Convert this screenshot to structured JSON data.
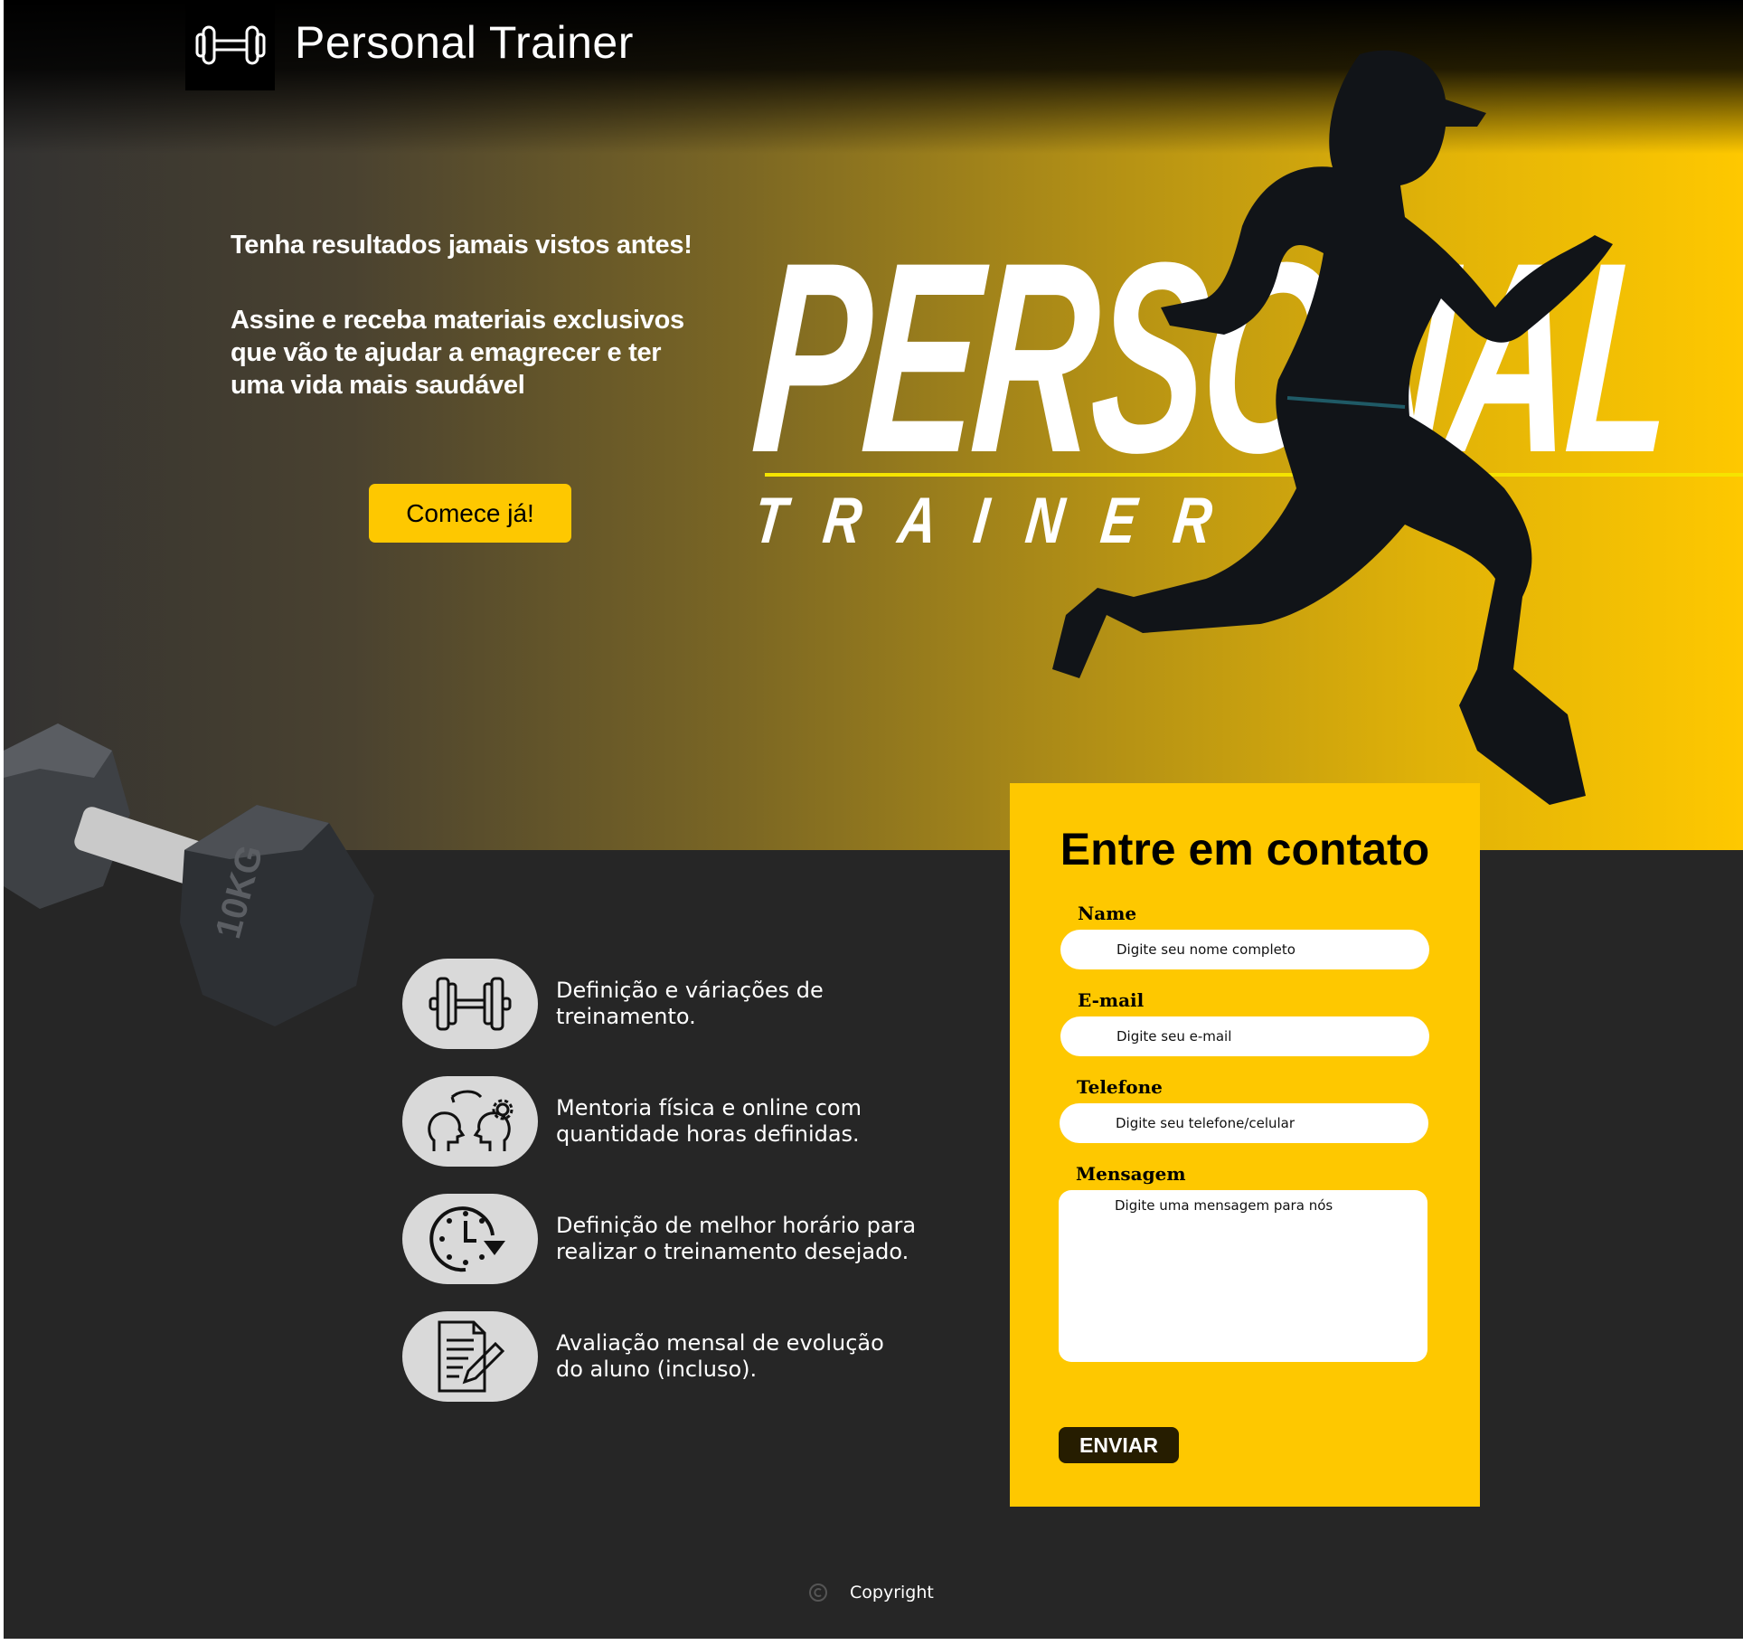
{
  "header": {
    "brand": "Personal Trainer",
    "logo_icon": "dumbbell-icon"
  },
  "hero": {
    "tagline": "Tenha resultados jamais vistos antes!",
    "pitch": "Assine e receba materiais exclusivos que vão te ajudar a emagrecer e ter uma vida mais saudável",
    "cta_label": "Comece já!",
    "banner_title": "PERSONAL",
    "banner_subtitle": "TRAINER"
  },
  "features": [
    {
      "icon": "dumbbell-icon",
      "text": "Definição e váriações de treinamento."
    },
    {
      "icon": "mentoring-heads-icon",
      "text": "Mentoria física e online com quantidade horas definidas."
    },
    {
      "icon": "clock-icon",
      "text": "Definição de melhor horário para realizar o treinamento desejado."
    },
    {
      "icon": "document-edit-icon",
      "text": "Avaliação mensal de evolução do aluno (incluso)."
    }
  ],
  "contact": {
    "title": "Entre em contato",
    "name_label": "Name",
    "name_placeholder": "Digite seu nome completo",
    "email_label": "E-mail",
    "email_placeholder": "Digite seu e-mail",
    "phone_label": "Telefone",
    "phone_placeholder": "Digite seu telefone/celular",
    "message_label": "Mensagem",
    "message_placeholder": "Digite uma mensagem para nós",
    "submit_label": "ENVIAR"
  },
  "footer": {
    "copyright": "Copyright"
  },
  "colors": {
    "accent": "#fec800",
    "dark": "#262626",
    "button_dark": "#261d00"
  }
}
